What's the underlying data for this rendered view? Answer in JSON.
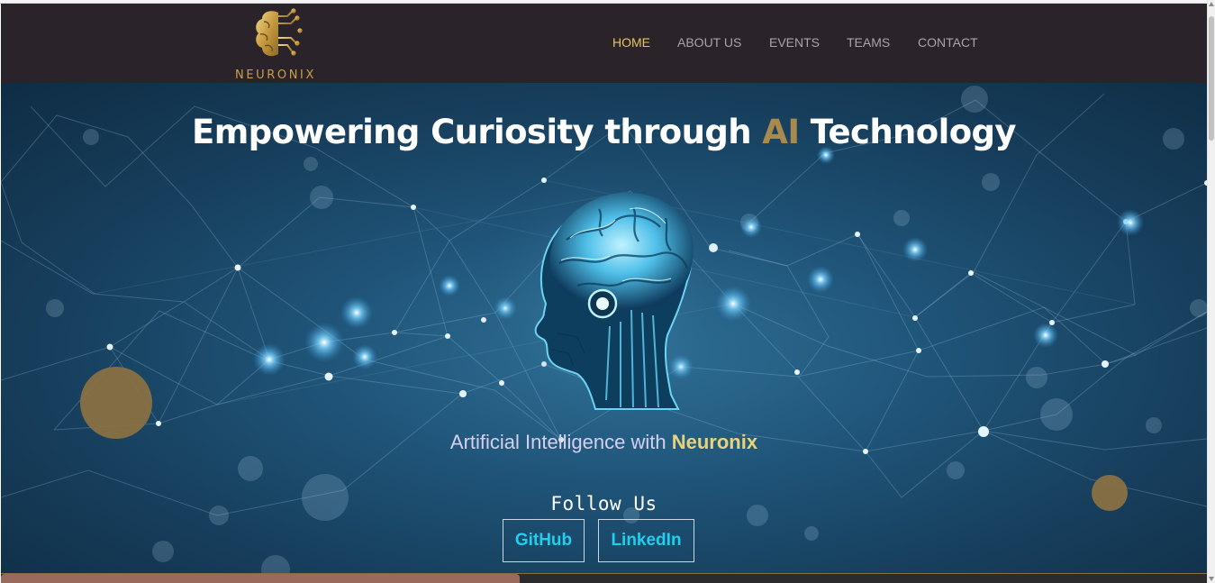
{
  "brand": {
    "name": "NEURONIX",
    "accent_color": "#c9a047"
  },
  "nav": {
    "items": [
      {
        "label": "HOME",
        "active": true
      },
      {
        "label": "ABOUT US",
        "active": false
      },
      {
        "label": "EVENTS",
        "active": false
      },
      {
        "label": "TEAMS",
        "active": false
      },
      {
        "label": "CONTACT",
        "active": false
      }
    ]
  },
  "hero": {
    "title_before": "Empowering Curiosity through ",
    "title_accent": "AI",
    "title_after": " Technology",
    "subtitle_before": "Artificial Intelligence with ",
    "subtitle_brand": "Neuronix",
    "follow_label": "Follow Us",
    "image": "ai-brain-head-icon"
  },
  "social": {
    "github_label": "GitHub",
    "linkedin_label": "LinkedIn"
  },
  "colors": {
    "nav_bg": "#2a2329",
    "nav_active": "#e4c461",
    "hero_bg": "#1f5478",
    "link_cyan": "#1fd0ee",
    "gold_accent": "#a88a4c"
  }
}
